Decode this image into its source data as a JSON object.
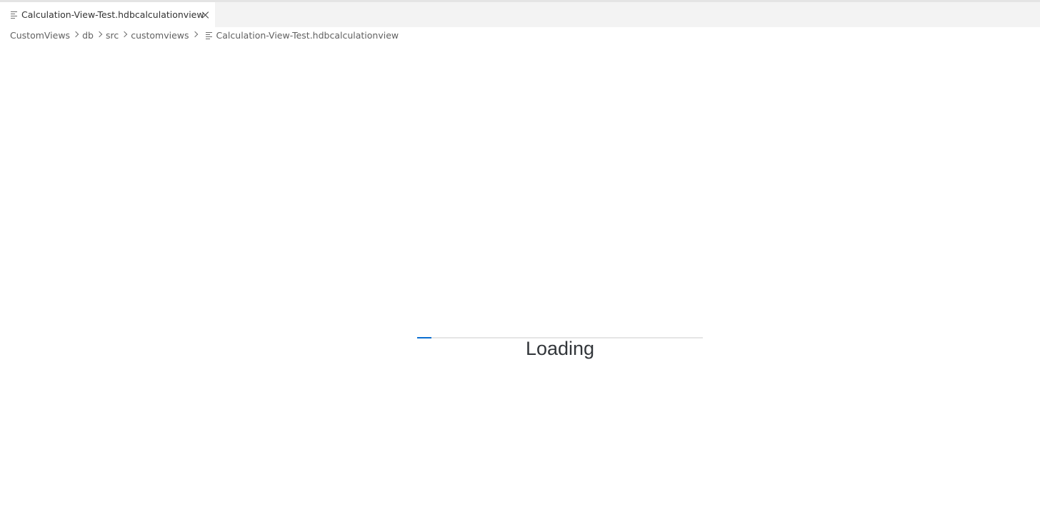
{
  "tab": {
    "title": "Calculation-View-Test.hdbcalculationview",
    "icon": "file-lines-icon",
    "close_icon": "close-icon"
  },
  "breadcrumb": {
    "items": [
      "CustomViews",
      "db",
      "src",
      "customviews"
    ],
    "file": "Calculation-View-Test.hdbcalculationview"
  },
  "loading": {
    "label": "Loading",
    "progress": 0.05,
    "accent_color": "#0a6ed1"
  }
}
